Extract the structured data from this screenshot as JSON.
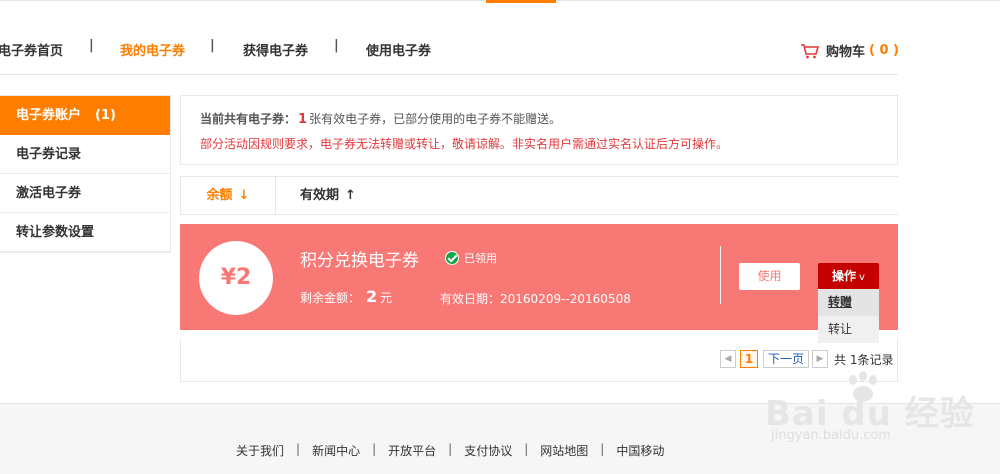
{
  "nav": {
    "items": [
      "电子券首页",
      "我的电子券",
      "获得电子券",
      "使用电子券"
    ],
    "separator": "|",
    "cart_label": "购物车",
    "cart_count": "( 0 )"
  },
  "sidebar": {
    "items": [
      {
        "label": "电子券账户",
        "count": "(1)"
      },
      {
        "label": "电子券记录"
      },
      {
        "label": "激活电子券"
      },
      {
        "label": "转让参数设置"
      }
    ]
  },
  "notice": {
    "prefix": "当前共有电子券：",
    "count": "1",
    "suffix": "张有效电子券，已部分使用的电子券不能赠送。",
    "warning": "部分活动因规则要求，电子券无法转赠或转让，敬请谅解。非实名用户需通过实名认证后方可操作。"
  },
  "sort": {
    "balance_label": "余额",
    "balance_arrow": "↓",
    "validity_label": "有效期",
    "validity_arrow": "↑"
  },
  "coupon": {
    "amount_badge": "¥2",
    "title": "积分兑换电子券",
    "status": "已领用",
    "remain_label": "剩余金额：",
    "remain_amount": "2",
    "remain_unit": "元",
    "expire_label": "有效日期：",
    "expire_range": "20160209--20160508",
    "use_button": "使用",
    "op_button": "操作",
    "op_chevron": "v"
  },
  "dropdown": {
    "items": [
      "转赠",
      "转让"
    ]
  },
  "pager": {
    "prev": "◀",
    "current": "1",
    "next": "下一页",
    "next_arrow": "▶",
    "total": "共 1条记录"
  },
  "footer": {
    "links": [
      "关于我们",
      "新闻中心",
      "开放平台",
      "支付协议",
      "网站地图",
      "中国移动"
    ]
  },
  "watermark": {
    "brand": "Bai du 经验",
    "url": "jingyan.baidu.com"
  },
  "colors": {
    "accent": "#ff7e00",
    "coupon_bg": "#f87876",
    "op_button_bg": "#c40000",
    "warning_text": "#e4393c"
  }
}
